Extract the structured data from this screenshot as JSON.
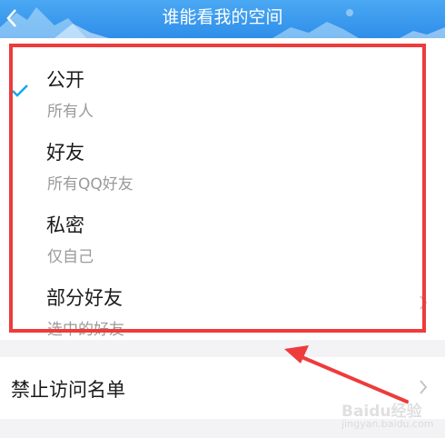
{
  "header": {
    "title": "谁能看我的空间",
    "back_icon": "chevron-left-icon"
  },
  "options": [
    {
      "title": "公开",
      "subtitle": "所有人",
      "selected": true,
      "has_chevron": false
    },
    {
      "title": "好友",
      "subtitle": "所有QQ好友",
      "selected": false,
      "has_chevron": false
    },
    {
      "title": "私密",
      "subtitle": "仅自己",
      "selected": false,
      "has_chevron": false
    },
    {
      "title": "部分好友",
      "subtitle": "选中的好友",
      "selected": false,
      "has_chevron": true
    }
  ],
  "blocked_list": {
    "label": "禁止访问名单",
    "icon": "chevron-right-icon"
  },
  "watermark": {
    "text": "Baidu经验",
    "sub": "jingyan.baidu.com"
  },
  "colors": {
    "header_blue": "#3a9bef",
    "check_blue": "#12a8f0",
    "annotation_red": "#ee3b3b",
    "separator": "#f3f3f5"
  }
}
